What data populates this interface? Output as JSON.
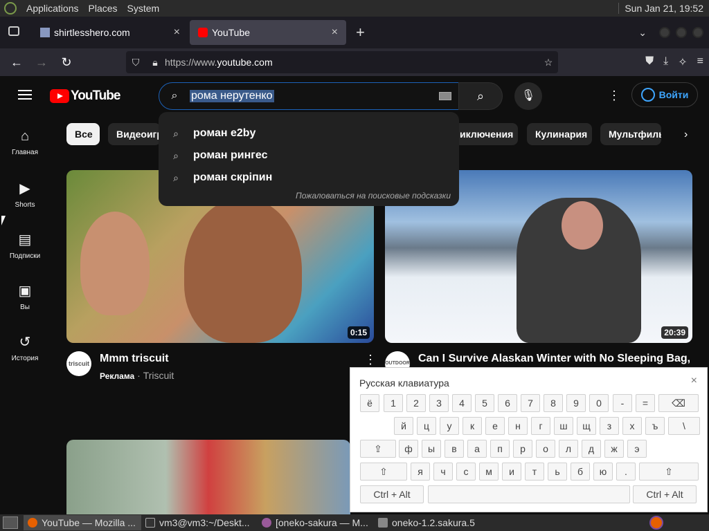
{
  "gnome": {
    "menu": [
      "Applications",
      "Places",
      "System"
    ],
    "clock": "Sun Jan 21, 19:52"
  },
  "browser": {
    "tabs": [
      {
        "title": "shirtlesshero.com",
        "close": "×"
      },
      {
        "title": "YouTube",
        "close": "×"
      }
    ],
    "new_tab": "+",
    "url_prefix": "https://www.",
    "url_host": "youtube.com"
  },
  "youtube": {
    "logo_text": "YouTube",
    "search_query": "рома нерутенко",
    "sign_in": "Войти",
    "guide": [
      {
        "icon": "⌂",
        "label": "Главная"
      },
      {
        "icon": "▶",
        "label": "Shorts"
      },
      {
        "icon": "▤",
        "label": "Подписки"
      },
      {
        "icon": "▣",
        "label": "Вы"
      },
      {
        "icon": "↺",
        "label": "История"
      }
    ],
    "chips": [
      "Все",
      "Видеоигр",
      "иключения",
      "Кулинария",
      "Мультфиль"
    ],
    "suggestions": [
      "роман e2by",
      "роман рингес",
      "роман скрiпин"
    ],
    "report_suggestions": "Пожаловаться на поисковые подсказки",
    "videos": [
      {
        "title": "Mmm triscuit",
        "channel_badge": "Реклама",
        "channel": "Triscuit",
        "duration": "0:15",
        "avatar": "triscuit"
      },
      {
        "title": "Can I Survive Alaskan Winter with No Sleeping Bag,",
        "duration": "20:39",
        "avatar": "OUTDOOR"
      }
    ]
  },
  "keyboard": {
    "title": "Русская клавиатура",
    "close": "×",
    "row1": [
      "ё",
      "1",
      "2",
      "3",
      "4",
      "5",
      "6",
      "7",
      "8",
      "9",
      "0",
      "-",
      "=",
      "⌫"
    ],
    "row2": [
      "й",
      "ц",
      "у",
      "к",
      "е",
      "н",
      "г",
      "ш",
      "щ",
      "з",
      "х",
      "ъ",
      "\\"
    ],
    "row3": [
      "⇪",
      "ф",
      "ы",
      "в",
      "а",
      "п",
      "р",
      "о",
      "л",
      "д",
      "ж",
      "э"
    ],
    "row4": [
      "⇧",
      "я",
      "ч",
      "с",
      "м",
      "и",
      "т",
      "ь",
      "б",
      "ю",
      ".",
      "⇧"
    ],
    "row5": [
      "Ctrl + Alt",
      "",
      "Ctrl + Alt"
    ]
  },
  "taskbar": [
    {
      "label": "YouTube — Mozilla ...",
      "active": true
    },
    {
      "label": "vm3@vm3:~/Deskt...",
      "active": false
    },
    {
      "label": "[oneko-sakura — M...",
      "active": false
    },
    {
      "label": "oneko-1.2.sakura.5",
      "active": false
    }
  ]
}
